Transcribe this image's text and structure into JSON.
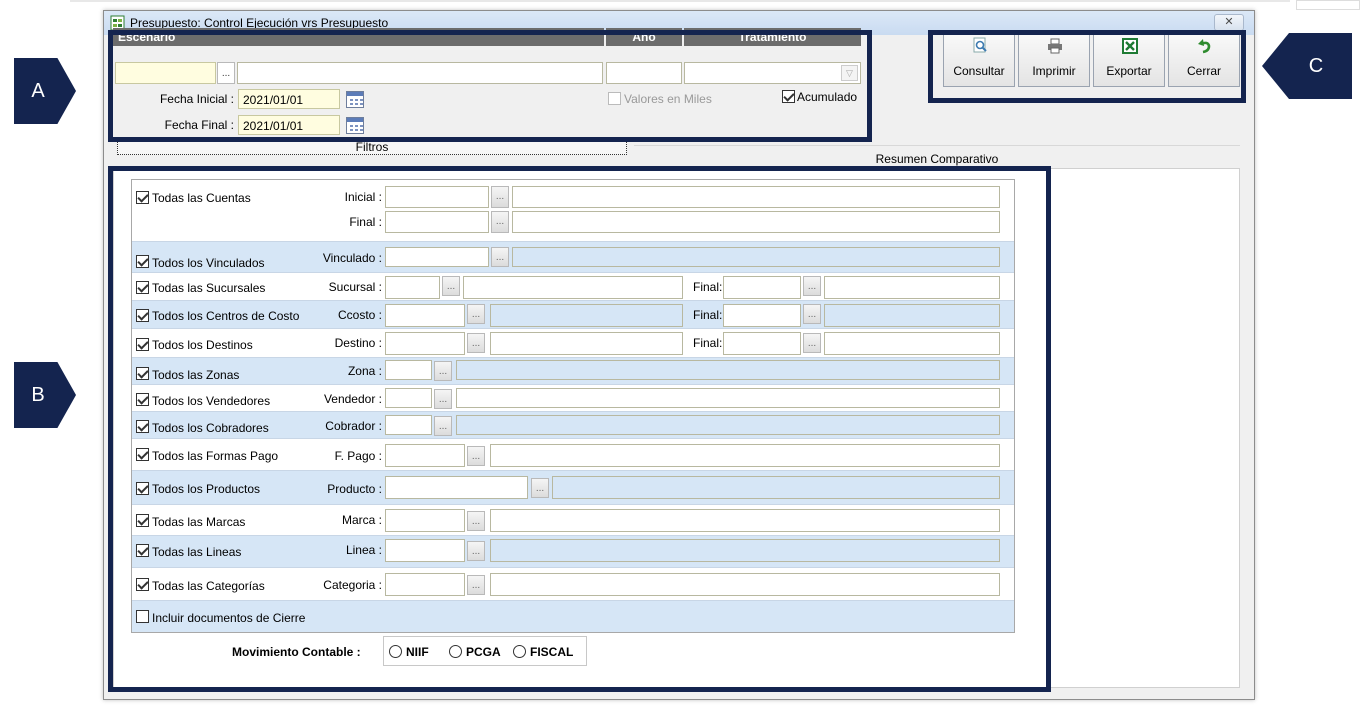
{
  "window": {
    "title": "Presupuesto: Control Ejecución vrs Presupuesto",
    "close_glyph": "✕"
  },
  "header": {
    "escenario": "Escenario",
    "anio": "Año",
    "tratamiento": "Tratamiento"
  },
  "params": {
    "fecha_inicial_label": "Fecha Inicial :",
    "fecha_inicial_value": "2021/01/01",
    "fecha_final_label": "Fecha Final :",
    "fecha_final_value": "2021/01/01",
    "valores_miles_label": "Valores en  Miles",
    "acumulado_label": "Acumulado",
    "dots": "..."
  },
  "toolbar": {
    "consultar": "Consultar",
    "imprimir": "Imprimir",
    "exportar": "Exportar",
    "cerrar": "Cerrar"
  },
  "tabs": {
    "filtros": "Filtros",
    "resumen": "Resumen Comparativo"
  },
  "filters": {
    "cuentas": {
      "check": "Todas las Cuentas",
      "inicial": "Inicial :",
      "final": "Final :"
    },
    "vinculados": {
      "check": "Todos los Vinculados",
      "field": "Vinculado :"
    },
    "sucursales": {
      "check": "Todas las Sucursales",
      "field": "Sucursal :",
      "final": "Final:"
    },
    "ccosto": {
      "check": "Todos los Centros de Costo",
      "field": "Ccosto :",
      "final": "Final:"
    },
    "destinos": {
      "check": "Todos los Destinos",
      "field": "Destino :",
      "final": "Final:"
    },
    "zonas": {
      "check": "Todos las Zonas",
      "field": "Zona :"
    },
    "vendedores": {
      "check": "Todos los Vendedores",
      "field": "Vendedor :"
    },
    "cobradores": {
      "check": "Todos los Cobradores",
      "field": "Cobrador :"
    },
    "formas_pago": {
      "check": "Todos las Formas Pago",
      "field": "F. Pago :"
    },
    "productos": {
      "check": "Todos los Productos",
      "field": "Producto :"
    },
    "marcas": {
      "check": "Todas las Marcas",
      "field": "Marca :"
    },
    "lineas": {
      "check": "Todas las Lineas",
      "field": "Linea :"
    },
    "categorias": {
      "check": "Todas las Categorías",
      "field": "Categoria :"
    },
    "cierre": {
      "check": "Incluir documentos de Cierre"
    }
  },
  "movimiento": {
    "label": "Movimiento Contable :",
    "niif": "NIIF",
    "pcga": "PCGA",
    "fiscal": "FISCAL"
  },
  "annotations": {
    "a": "A",
    "b": "B",
    "c": "C"
  },
  "colors": {
    "annotation": "#14244f",
    "row_alt": "#d6e6f6",
    "header": "#6c6c6c",
    "input_yellow": "#fffde0"
  }
}
